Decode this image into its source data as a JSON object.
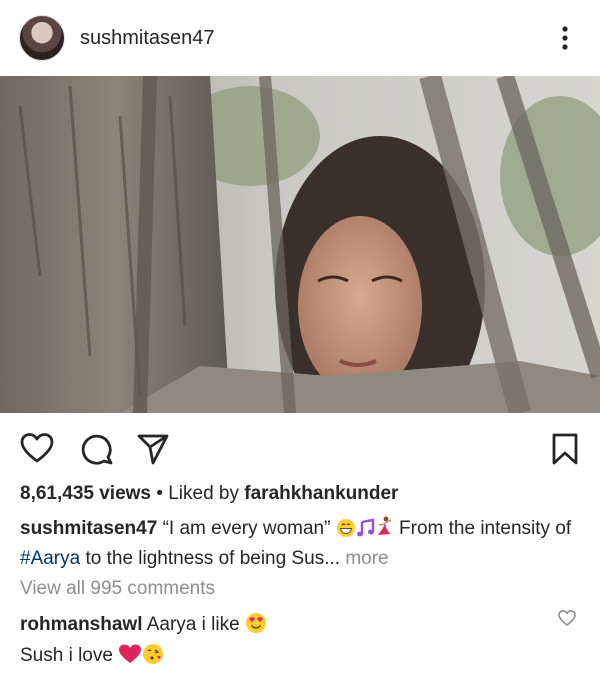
{
  "header": {
    "username": "sushmitasen47",
    "more_icon": "three-dots-vertical-icon"
  },
  "actions": {
    "like_icon": "heart-outline-icon",
    "comment_icon": "speech-bubble-icon",
    "share_icon": "paper-plane-icon",
    "save_icon": "bookmark-icon"
  },
  "stats": {
    "views": "8,61,435 views",
    "separator": "•",
    "liked_by_prefix": "Liked by",
    "liked_by_user": "farahkhankunder"
  },
  "caption": {
    "username": "sushmitasen47",
    "text_before": "“I am every woman”",
    "text_after": "From the intensity of",
    "hashtag": "#Aarya",
    "text_end": "to the lightness of being Sus...",
    "more_label": "more"
  },
  "comments": {
    "view_all_label": "View all 995 comments",
    "items": [
      {
        "username": "rohmanshawl",
        "text_line1": "Aarya i like",
        "text_line2": "Sush i love"
      }
    ]
  },
  "colors": {
    "text": "#262626",
    "muted": "#8e8e8e",
    "hashtag": "#00376b",
    "heart_red": "#e0245e"
  }
}
